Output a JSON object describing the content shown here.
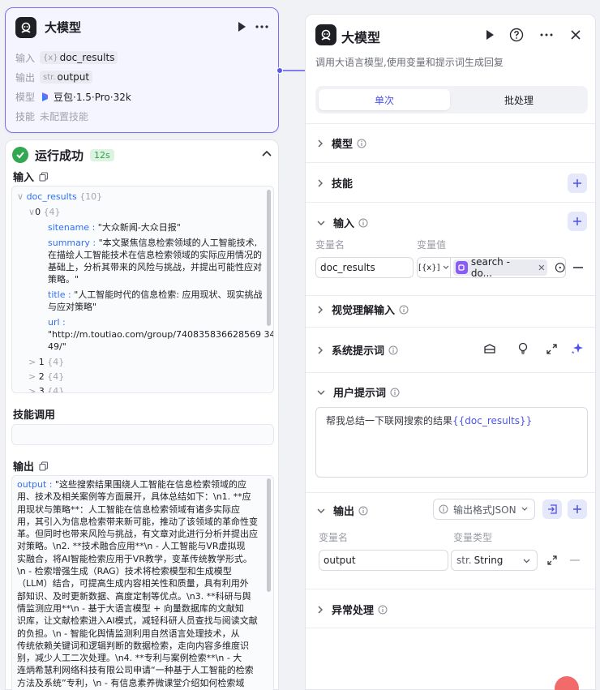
{
  "node": {
    "title": "大模型",
    "rows": [
      {
        "label": "输入",
        "type_prefix": "{x}",
        "value": "doc_results"
      },
      {
        "label": "输出",
        "type_prefix": "str.",
        "value": "output"
      },
      {
        "label": "模型",
        "value": "豆包·1.5·Pro·32k"
      },
      {
        "label": "技能",
        "value": "未配置技能"
      }
    ]
  },
  "run": {
    "status": "运行成功",
    "duration": "12s",
    "input_title": "输入",
    "skill_title": "技能调用",
    "output_title": "输出",
    "input_tree": {
      "root_key": "doc_results",
      "root_count": "{10}",
      "item0_key": "0",
      "item0_count": "{4}",
      "sitename_key": "sitename",
      "sitename_val": "\"大众新闻-大众日报\"",
      "summary_key": "summary",
      "summary_val_1": "\"本文聚焦信息检索领域的人工智能技术,",
      "summary_val_2": "在描绘人工智能技术在信息检索领域的实际应用情况的",
      "summary_val_3": "基础上，分析其带来的风险与挑战，并提出可能性应对",
      "summary_val_4": "策略。\"",
      "title_key": "title",
      "title_val_1": "\"人工智能时代的信息检索: 应用现状、现实挑战",
      "title_val_2": "与应对策略\"",
      "url_key": "url",
      "url_val_1": "\"http://m.toutiao.com/group/740835836628569 34",
      "url_val_2": "49/\"",
      "collapsed": [
        {
          "key": "1",
          "count": "{4}"
        },
        {
          "key": "2",
          "count": "{4}"
        },
        {
          "key": "3",
          "count": "{4}"
        }
      ]
    },
    "output_key": "output",
    "output_lines": [
      "\"这些搜索结果围绕人工智能在信息检索领域的应",
      "用、技术及相关案例等方面展开，具体总结如下：\\n1. **应",
      "用现状与策略**：人工智能在信息检索领域有诸多实际应",
      "用，其引入为信息检索带来新可能，推动了该领域的革命性变",
      "革。但同时也带来风险与挑战，有文章对此进行分析并提出应",
      "对策略。\\n2. **技术融合应用**\\n   - 人工智能与VR虚拟现",
      "实融合，将AI智能检索应用于VR教学，变革传统教学形式。",
      "\\n   - 检索增强生成（RAG）技术将检索模型和生成模型",
      "（LLM）结合，可提高生成内容相关性和质量，具有利用外",
      "部知识、及时更新数据、高度定制等优点。\\n3. **科研与舆",
      "情监测应用**\\n   - 基于大语言模型 + 向量数据库的文献知",
      "识库，让文献检索进入AI模式，减轻科研人员查找与阅读文献",
      "的负担。\\n   - 智能化舆情监测利用自然语言处理技术，从",
      "传统依赖关键词和逻辑判断的数据检索，走向内容多维度识",
      "别，减少人工二次处理。\\n4. **专利与案例检索**\\n   - 大",
      "连炳希慧利网络科技有限公司申请“一种基于人工智能的检索",
      "方法及系统”专利，\\n   - 有信息素养微课堂介绍如何检索域"
    ]
  },
  "panel": {
    "title": "大模型",
    "description": "调用大语言模型,使用变量和提示词生成回复",
    "tabs": [
      "单次",
      "批处理"
    ],
    "sections": {
      "model": "模型",
      "skills": "技能",
      "input": "输入",
      "vision": "视觉理解输入",
      "system_prompt": "系统提示词",
      "user_prompt": "用户提示词",
      "output": "输出",
      "exception": "异常处理"
    },
    "input_labels": {
      "name": "变量名",
      "value": "变量值"
    },
    "input_var_name": "doc_results",
    "input_ref_type": "[{x}]",
    "input_ref_value": "search - do...",
    "user_prompt_text": "帮我总结一下联网搜索的结果",
    "user_prompt_var": "{{doc_results}}",
    "output_format": "输出格式JSON",
    "output_labels": {
      "name": "变量名",
      "type": "变量类型"
    },
    "output_var_name": "output",
    "output_type_prefix": "str.",
    "output_type": "String"
  },
  "colors": {
    "accent": "#4d53e8",
    "success": "#32a852",
    "node_border": "#7b6ff2",
    "plugin": "#8a5cf6"
  }
}
